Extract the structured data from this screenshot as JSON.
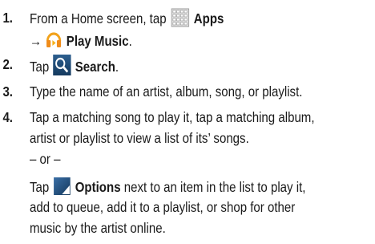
{
  "steps": [
    {
      "number": "1.",
      "text_before": "From a Home screen, tap",
      "apps_label": "Apps",
      "arrow": "→",
      "play_music_label": "Play Music",
      "period": "."
    },
    {
      "number": "2.",
      "text_before": "Tap",
      "search_label": "Search",
      "period": "."
    },
    {
      "number": "3.",
      "text": "Type the name of an artist, album, song, or playlist."
    },
    {
      "number": "4.",
      "line1": "Tap a matching song to play it, tap a matching album,",
      "line2": "artist or playlist to view a list of its’ songs.",
      "or_text": "– or –",
      "alt_before": "Tap",
      "options_label": "Options",
      "alt_line1_rest": "next to an item in the list to play it,",
      "alt_line2": "add to queue, add it to a playlist, or shop for other",
      "alt_line3": "music by the artist online."
    }
  ],
  "icons": {
    "apps": "apps-grid-icon",
    "play_music": "headphones-icon",
    "search": "magnifier-icon",
    "options": "corner-triangle-icon"
  }
}
